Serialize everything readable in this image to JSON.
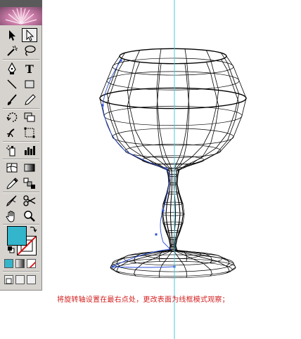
{
  "toolbox": {
    "tools": [
      {
        "name": "selection-tool",
        "icon": "black-arrow-icon"
      },
      {
        "name": "direct-selection-tool",
        "icon": "white-arrow-icon",
        "selected": true
      },
      {
        "name": "magic-wand-tool",
        "icon": "magic-wand-icon"
      },
      {
        "name": "lasso-tool",
        "icon": "lasso-icon"
      },
      {
        "name": "pen-tool",
        "icon": "pen-icon"
      },
      {
        "name": "type-tool",
        "icon": "type-icon",
        "glyph": "T"
      },
      {
        "name": "line-segment-tool",
        "icon": "line-icon"
      },
      {
        "name": "rectangle-tool",
        "icon": "rectangle-icon"
      },
      {
        "name": "paintbrush-tool",
        "icon": "brush-icon"
      },
      {
        "name": "pencil-tool",
        "icon": "pencil-icon"
      },
      {
        "name": "rotate-tool",
        "icon": "rotate-icon"
      },
      {
        "name": "scale-tool",
        "icon": "scale-icon"
      },
      {
        "name": "warp-tool",
        "icon": "warp-icon"
      },
      {
        "name": "free-transform-tool",
        "icon": "free-transform-icon"
      },
      {
        "name": "symbol-sprayer-tool",
        "icon": "spray-icon"
      },
      {
        "name": "column-graph-tool",
        "icon": "graph-icon"
      },
      {
        "name": "mesh-tool",
        "icon": "mesh-icon"
      },
      {
        "name": "gradient-tool",
        "icon": "gradient-icon"
      },
      {
        "name": "eyedropper-tool",
        "icon": "eyedropper-icon"
      },
      {
        "name": "blend-tool",
        "icon": "blend-icon"
      },
      {
        "name": "slice-tool",
        "icon": "slice-icon"
      },
      {
        "name": "scissors-tool",
        "icon": "scissors-icon"
      },
      {
        "name": "hand-tool",
        "icon": "hand-icon"
      },
      {
        "name": "zoom-tool",
        "icon": "zoom-icon"
      }
    ],
    "fill_color": "#33b5cc",
    "stroke_color": "none"
  },
  "guide_color": "#4cc8dc",
  "caption": {
    "text": "将旋转轴设置在最右点处，更改表面为线框模式观察；",
    "color": "#d42020"
  }
}
